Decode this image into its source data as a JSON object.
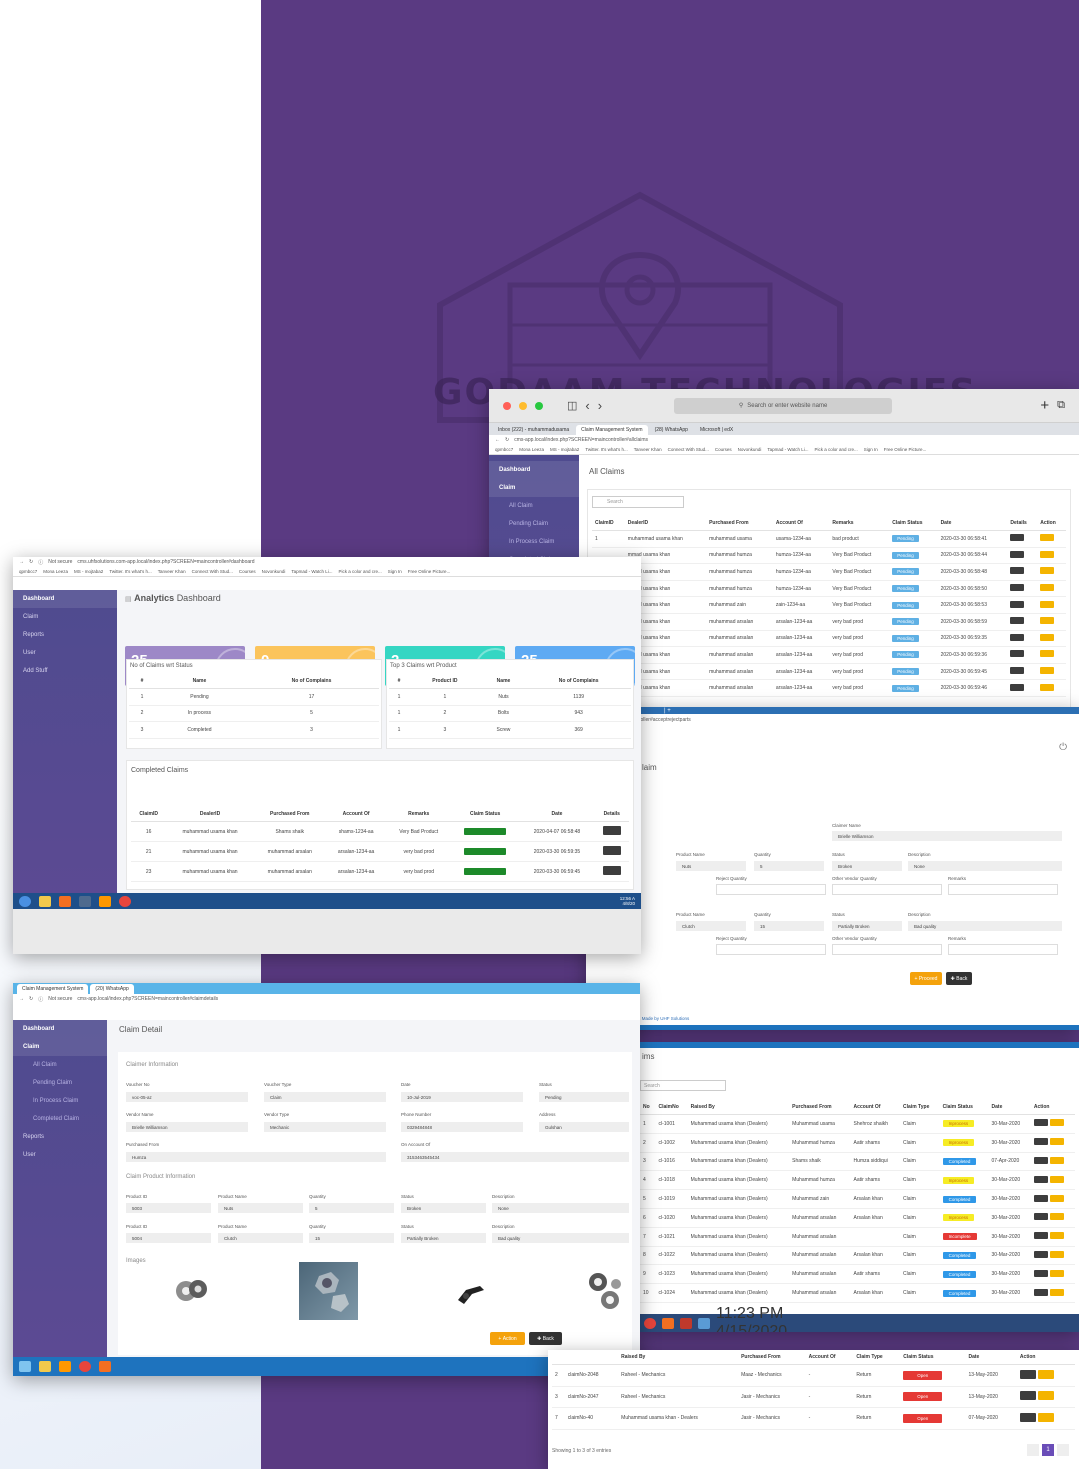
{
  "watermark": {
    "text": "GODAAM TECHNOLOGIES"
  },
  "mac": {
    "search_placeholder": "Search or enter website name"
  },
  "all_claims": {
    "tabs": [
      "Inbox (222) - muhammadusama",
      "Claim Management System",
      "(28) WhatsApp",
      "Microsoft | edX"
    ],
    "address": "cms-app.local/index.php?SCREEN=maincontroller#allclaims",
    "bookmarks": [
      "qpmbcc7",
      "Mona Leeza",
      "MS - mojtaba2",
      "Twitter. It's what's h...",
      "Tanveer Khan",
      "Connect With Stud...",
      "Courses",
      "Novonkundi",
      "Tapmad - Watch Li...",
      "Pick a color and cre...",
      "Sign In",
      "Free Online Picture..."
    ],
    "sidebar": [
      {
        "label": "Dashboard",
        "active": true
      },
      {
        "label": "Claim",
        "active": true
      },
      {
        "label": "All Claim",
        "sub": true
      },
      {
        "label": "Pending Claim",
        "sub": true
      },
      {
        "label": "In Process Claim",
        "sub": true
      },
      {
        "label": "Completed Claim",
        "sub": true
      }
    ],
    "title": "All Claims",
    "search_placeholder": "Search",
    "columns": [
      "ClaimID",
      "DealerID",
      "Purchased From",
      "Account Of",
      "Remarks",
      "Claim Status",
      "Date",
      "Details",
      "Action"
    ],
    "rows": [
      [
        "1",
        "muhammad usama khan",
        "muhammad usama",
        "usama-1234-aa",
        "bad product",
        "Pending",
        "2020-03-30 06:58:41"
      ],
      [
        "",
        "mmad usama khan",
        "muhammad humza",
        "humza-1234-aa",
        "Very Bad Product",
        "Pending",
        "2020-03-30 06:58:44"
      ],
      [
        "",
        "mmad usama khan",
        "muhammad humza",
        "humza-1234-aa",
        "Very Bad Product",
        "Pending",
        "2020-03-30 06:58:48"
      ],
      [
        "",
        "mmad usama khan",
        "muhammad humza",
        "humza-1234-aa",
        "Very Bad Product",
        "Pending",
        "2020-03-30 06:58:50"
      ],
      [
        "",
        "mmad usama khan",
        "muhammad zain",
        "zain-1234-aa",
        "Very Bad Product",
        "Pending",
        "2020-03-30 06:58:53"
      ],
      [
        "",
        "mmad usama khan",
        "muhammad arsalan",
        "arsalan-1234-aa",
        "very bad prod",
        "Pending",
        "2020-03-30 06:58:59"
      ],
      [
        "",
        "mmad usama khan",
        "muhammad arsalan",
        "arsalan-1234-aa",
        "very bad prod",
        "Pending",
        "2020-03-30 06:59:35"
      ],
      [
        "",
        "mmad usama khan",
        "muhammad arsalan",
        "arsalan-1234-aa",
        "very bad prod",
        "Pending",
        "2020-03-30 06:59:36"
      ],
      [
        "",
        "mmad usama khan",
        "muhammad arsalan",
        "arsalan-1234-aa",
        "very bad prod",
        "Pending",
        "2020-03-30 06:59:45"
      ],
      [
        "",
        "mmad usama khan",
        "muhammad arsalan",
        "arsalan-1234-aa",
        "very bad prod",
        "Pending",
        "2020-03-30 06:59:46"
      ]
    ]
  },
  "inner_claim": {
    "address": "?SCREEN=maincontroller#acceptrejectparts",
    "title": "laim",
    "claimer_name_label": "Claimer Name",
    "claimer_name": "Brielle Williamson",
    "product_rows": [
      {
        "name": "Nuts",
        "qty": "5",
        "status": "Broken",
        "desc": "None"
      },
      {
        "name": "Clutch",
        "qty": "15",
        "status": "Partially Broken",
        "desc": "Bad quality"
      }
    ],
    "labels": {
      "product_name": "Product Name",
      "quantity": "Quantity",
      "status": "Status",
      "description": "Description",
      "reject_qty": "Reject Quantity",
      "other_vendor_qty": "Other Vendor Quantity",
      "remarks": "Remarks"
    },
    "proceed": "Proceed",
    "back": "Back",
    "footer": "t. Made by UHF Solutions"
  },
  "dashboard": {
    "address_prefix": "Not secure",
    "address": "cms.uhfsolutions.com-app.local/index.php?SCREEN=maincontroller#dashboard",
    "bookmarks": [
      "qpmbcc7",
      "Mona Leeza",
      "MS - mojtaba2",
      "Twitter. It's what's h...",
      "Tanveer Khan",
      "Connect With Stud...",
      "Courses",
      "Novonkundi",
      "Tapmad - Watch Li...",
      "Pick a color and cre...",
      "Sign In",
      "Free Online Picture..."
    ],
    "sidebar": [
      {
        "label": "Dashboard",
        "active": true
      },
      {
        "label": "Claim"
      },
      {
        "label": "Reports"
      },
      {
        "label": "User"
      },
      {
        "label": "Add Stuff"
      }
    ],
    "title_bold": "Analytics",
    "title_rest": "Dashboard",
    "kpis": [
      {
        "value": "25",
        "label": "Total Claims",
        "color": "#9d88c7"
      },
      {
        "value": "0",
        "label": "Reported Today",
        "color": "#fbc45c"
      },
      {
        "value": "2",
        "label": "Reported This Month",
        "color": "#35d6c3"
      },
      {
        "value": "25",
        "label": "Reported This Year",
        "color": "#5eaaf3"
      }
    ],
    "status_table": {
      "title": "No of Claims wrt Status",
      "columns": [
        "#",
        "Name",
        "No of Complains"
      ],
      "rows": [
        [
          "1",
          "Pending",
          "17"
        ],
        [
          "2",
          "In process",
          "5"
        ],
        [
          "3",
          "Completed",
          "3"
        ]
      ]
    },
    "product_table": {
      "title": "Top 3 Claims wrt Product",
      "columns": [
        "#",
        "Product ID",
        "Name",
        "No of Complains"
      ],
      "rows": [
        [
          "1",
          "1",
          "Nuts",
          "1139"
        ],
        [
          "1",
          "2",
          "Bolts",
          "943"
        ],
        [
          "1",
          "3",
          "Screw",
          "369"
        ]
      ]
    },
    "completed": {
      "title": "Completed Claims",
      "columns": [
        "ClaimID",
        "DealerID",
        "Purchased From",
        "Account Of",
        "Remarks",
        "Claim Status",
        "Date",
        "Details"
      ],
      "rows": [
        [
          "16",
          "muhammad usama khan",
          "Shams shaik",
          "shams-1234-aa",
          "Very Bad Product",
          "Completed",
          "2020-04-07 06:58:48"
        ],
        [
          "21",
          "muhammad usama khan",
          "muhammad arsalan",
          "arsalan-1234-aa",
          "very bad prod",
          "Completed",
          "2020-03-30 06:59:35"
        ],
        [
          "23",
          "muhammad usama khan",
          "muhammad arsalan",
          "arsalan-1234-aa",
          "very bad prod",
          "Completed",
          "2020-03-30 06:59:45"
        ]
      ]
    },
    "clock": [
      "12:56 A",
      "4/8/20"
    ]
  },
  "detail": {
    "tabs": [
      "Claim Management System",
      "(20) WhatsApp"
    ],
    "address": "cms-app.local/index.php?SCREEN=maincontroller#claimdetails",
    "sidebar": [
      {
        "label": "Dashboard",
        "active": true
      },
      {
        "label": "Claim",
        "active": true
      },
      {
        "label": "All Claim",
        "sub": true
      },
      {
        "label": "Pending Claim",
        "sub": true
      },
      {
        "label": "In Process Claim",
        "sub": true
      },
      {
        "label": "Completed Claim",
        "sub": true
      },
      {
        "label": "Reports"
      },
      {
        "label": "User"
      }
    ],
    "title": "Claim Detail",
    "claimer_section": "Claimer Information",
    "fields": {
      "voucher_no_l": "Voucher No",
      "voucher_no": "voc-05-az",
      "voucher_type_l": "Voucher Type",
      "voucher_type": "Claim",
      "date_l": "Date",
      "date": "10-Jul-2019",
      "status_l": "Status",
      "status": "Pending",
      "vendor_name_l": "Vendor Name",
      "vendor_name": "Brielle Williamson",
      "vendor_type_l": "Vendor Type",
      "vendor_type": "Mechanic",
      "phone_l": "Phone Number",
      "phone": "0329484848",
      "address_l": "Address",
      "address": "Gulshan",
      "purchased_from_l": "Purchased From",
      "purchased_from": "Humza",
      "on_account_l": "On Account Of",
      "on_account": "3153463545434"
    },
    "product_section": "Claim Product Information",
    "product_labels": [
      "Product ID",
      "Product Name",
      "Quantity",
      "Status",
      "Description"
    ],
    "products": [
      [
        "5003",
        "Nuts",
        "5",
        "Broken",
        "None"
      ],
      [
        "5004",
        "Clutch",
        "15",
        "Partially Broken",
        "Bad quality"
      ]
    ],
    "images_label": "Images",
    "action": "Action",
    "back": "Back"
  },
  "all_claims_2": {
    "title": "ims",
    "search_placeholder": "Search",
    "columns": [
      "No",
      "ClaimNo",
      "Raised By",
      "Purchased From",
      "Account Of",
      "Claim Type",
      "Claim Status",
      "Date",
      "Action"
    ],
    "rows": [
      [
        "1",
        "cl-1001",
        "Muhammad usama khan (Dealers)",
        "Muhammad usama",
        "Shehroz shaikh",
        "Claim",
        "Inprocess",
        "30-Mar-2020"
      ],
      [
        "2",
        "cl-1002",
        "Muhammad usama khan (Dealers)",
        "Muhammad humza",
        "Aatir shams",
        "Claim",
        "Inprocess",
        "30-Mar-2020"
      ],
      [
        "3",
        "cl-1016",
        "Muhammad usama khan (Dealers)",
        "Shams shaik",
        "Humza siddiqui",
        "Claim",
        "Completed",
        "07-Apr-2020"
      ],
      [
        "4",
        "cl-1018",
        "Muhammad usama khan (Dealers)",
        "Muhammad humza",
        "Aatir shams",
        "Claim",
        "Inprocess",
        "30-Mar-2020"
      ],
      [
        "5",
        "cl-1019",
        "Muhammad usama khan (Dealers)",
        "Muhammad zain",
        "Arsalan khan",
        "Claim",
        "Completed",
        "30-Mar-2020"
      ],
      [
        "6",
        "cl-1020",
        "Muhammad usama khan (Dealers)",
        "Muhammad arsalan",
        "Arsalan khan",
        "Claim",
        "Inprocess",
        "30-Mar-2020"
      ],
      [
        "7",
        "cl-1021",
        "Muhammad usama khan (Dealers)",
        "Muhammad arsalan",
        "",
        "Claim",
        "Incomplete",
        "30-Mar-2020"
      ],
      [
        "8",
        "cl-1022",
        "Muhammad usama khan (Dealers)",
        "Muhammad arsalan",
        "Arsalan khan",
        "Claim",
        "Completed",
        "30-Mar-2020"
      ],
      [
        "9",
        "cl-1023",
        "Muhammad usama khan (Dealers)",
        "Muhammad arsalan",
        "Aatir shams",
        "Claim",
        "Completed",
        "30-Mar-2020"
      ],
      [
        "10",
        "cl-1024",
        "Muhammad usama khan (Dealers)",
        "Muhammad arsalan",
        "Arsalan khan",
        "Claim",
        "Completed",
        "30-Mar-2020"
      ]
    ],
    "clock": [
      "11:23 PM",
      "4/15/2020"
    ]
  },
  "open_claims": {
    "columns": [
      "",
      "",
      "Raised By",
      "Purchased From",
      "Account Of",
      "Claim Type",
      "Claim Status",
      "Date",
      "Action"
    ],
    "rows": [
      [
        "2",
        "claimNo-2048",
        "Raheel - Mechanics",
        "Maaz - Mechanics",
        "-",
        "Return",
        "Open",
        "13-May-2020"
      ],
      [
        "3",
        "claimNo-2047",
        "Raheel - Mechanics",
        "Jasir - Mechanics",
        "-",
        "Return",
        "Open",
        "13-May-2020"
      ],
      [
        "7",
        "claimNo-40",
        "Muhammad usama khan - Dealers",
        "Jasir - Mechanics",
        "-",
        "Return",
        "Open",
        "07-May-2020"
      ]
    ],
    "footer": "Showing 1 to 3 of 3 entries",
    "page": "1"
  },
  "colors": {
    "purple_bg": "#5a3a82",
    "pending": "#5fb0e4",
    "completed": "#1d8a2a",
    "inprocess": "#f6ec25",
    "completed_blue": "#2f98e8",
    "incomplete": "#e53935",
    "open": "#e53935",
    "edit": "#f4b400"
  }
}
